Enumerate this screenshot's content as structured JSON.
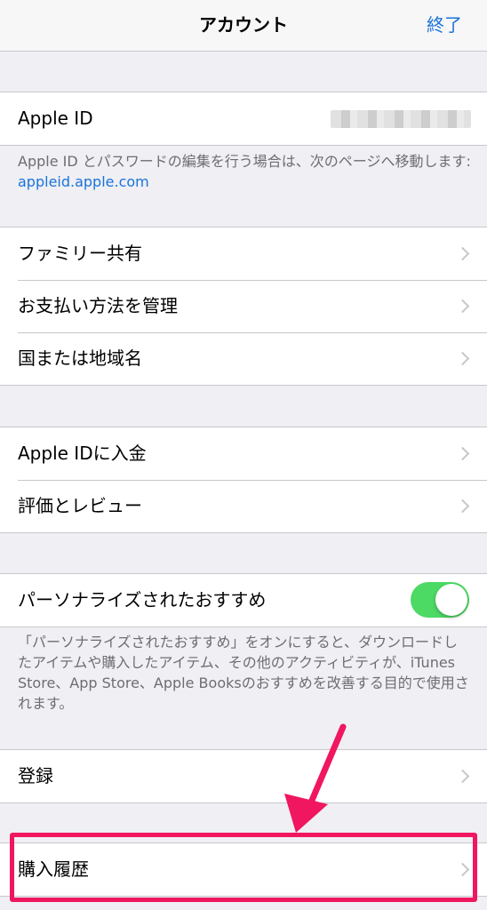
{
  "navbar": {
    "title": "アカウント",
    "done_label": "終了"
  },
  "apple_id": {
    "label": "Apple ID",
    "value": "",
    "footnote_text": "Apple ID とパスワードの編集を行う場合は、次のページへ移動します: ",
    "footnote_link": "appleid.apple.com"
  },
  "group1": {
    "items": [
      {
        "label": "ファミリー共有"
      },
      {
        "label": "お支払い方法を管理"
      },
      {
        "label": "国または地域名"
      }
    ]
  },
  "group2": {
    "items": [
      {
        "label": "Apple IDに入金"
      },
      {
        "label": "評価とレビュー"
      }
    ]
  },
  "personalize": {
    "label": "パーソナライズされたおすすめ",
    "enabled": true,
    "footnote": "「パーソナライズされたおすすめ」をオンにすると、ダウンロードしたアイテムや購入したアイテム、その他のアクティビティが、iTunes Store、App Store、Apple Booksのおすすめを改善する目的で使用されます。"
  },
  "subscriptions": {
    "label": "登録"
  },
  "purchase_history": {
    "label": "購入履歴"
  },
  "colors": {
    "accent": "#1a73d9",
    "toggle_on": "#4cd964",
    "highlight": "#f0165f",
    "background": "#efeff4"
  },
  "icons": {
    "chevron": "chevron-right-icon",
    "annotation_arrow": "arrow-down-left-icon"
  }
}
